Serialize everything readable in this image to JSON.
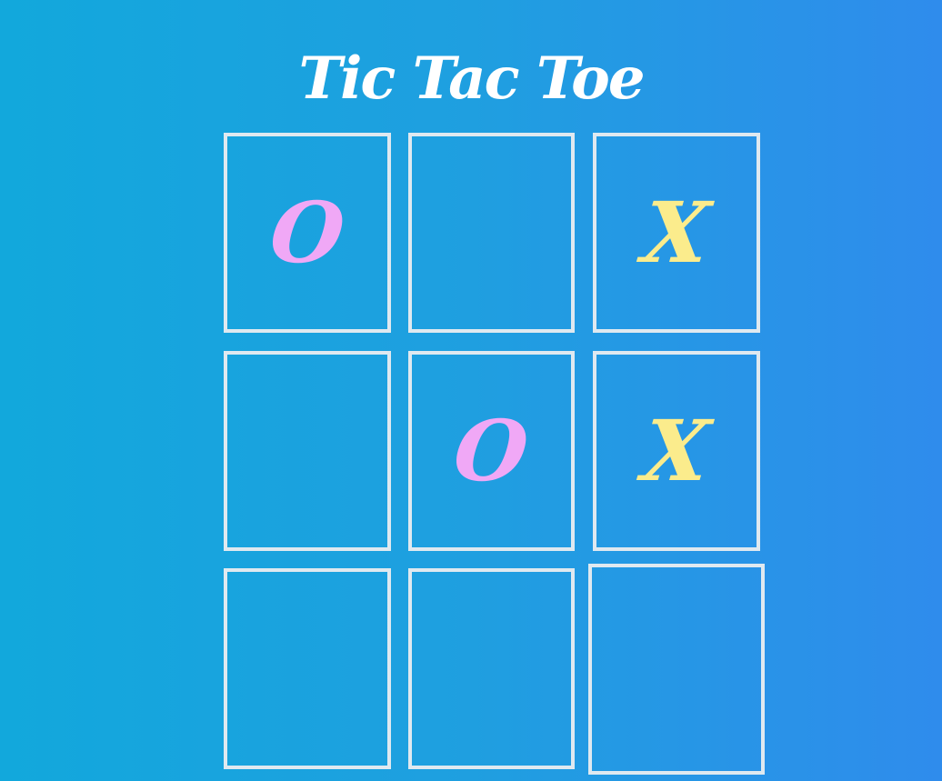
{
  "title": "Tic Tac Toe",
  "board": {
    "cells": [
      {
        "mark": "O",
        "kind": "o"
      },
      {
        "mark": "",
        "kind": "empty"
      },
      {
        "mark": "X",
        "kind": "x"
      },
      {
        "mark": "",
        "kind": "empty"
      },
      {
        "mark": "O",
        "kind": "o"
      },
      {
        "mark": "X",
        "kind": "x"
      },
      {
        "mark": "",
        "kind": "empty"
      },
      {
        "mark": "",
        "kind": "empty"
      },
      {
        "mark": "",
        "kind": "empty"
      }
    ]
  },
  "colors": {
    "o_mark": "#f0a8f6",
    "x_mark": "#fbec8c",
    "cell_border": "#dfe9f0",
    "background_start": "#12a8dc",
    "background_end": "#2f8cec"
  }
}
